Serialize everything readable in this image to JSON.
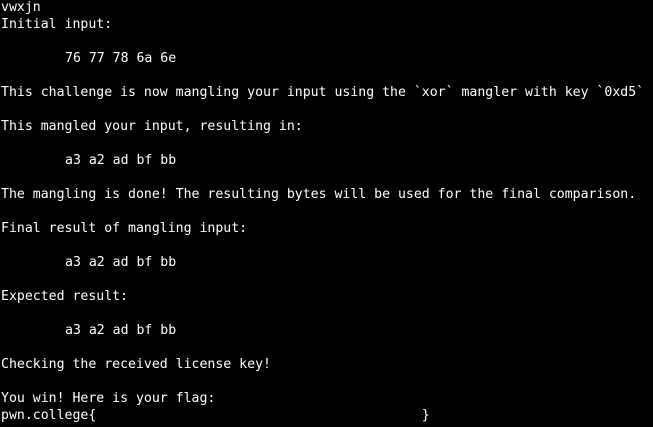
{
  "terminal": {
    "lines": {
      "l0": "vwxjn",
      "l1": "Initial input:",
      "l3": "76 77 78 6a 6e",
      "l5": "This challenge is now mangling your input using the `xor` mangler with key `0xd5`",
      "l7": "This mangled your input, resulting in:",
      "l9": "a3 a2 ad bf bb",
      "l11": "The mangling is done! The resulting bytes will be used for the final comparison.",
      "l13": "Final result of mangling input:",
      "l15": "a3 a2 ad bf bb",
      "l17": "Expected result:",
      "l19": "a3 a2 ad bf bb",
      "l21": "Checking the received license key!",
      "l23": "You win! Here is your flag:",
      "l24": "pwn.college{                                         }"
    }
  }
}
